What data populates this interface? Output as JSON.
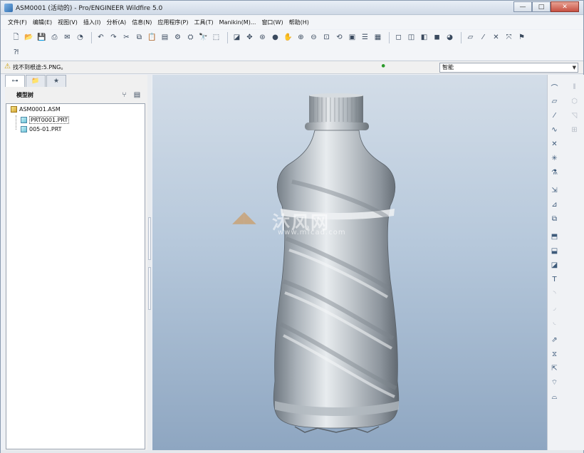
{
  "window": {
    "title": "ASM0001 (活动的) - Pro/ENGINEER Wildfire 5.0",
    "minimize": "—",
    "maximize": "□",
    "close": "✕"
  },
  "menu": [
    "文件(F)",
    "编辑(E)",
    "视图(V)",
    "插入(I)",
    "分析(A)",
    "信息(N)",
    "应用程序(P)",
    "工具(T)",
    "Manikin(M)...",
    "窗口(W)",
    "帮助(H)"
  ],
  "message": {
    "icon": "warning-icon",
    "text": "找不到根途:5.PNG。"
  },
  "filter": {
    "value": "智能"
  },
  "model_tree": {
    "title": "模型树",
    "nodes": [
      {
        "label": "ASM0001.ASM",
        "type": "assembly"
      },
      {
        "label": "PRT0001.PRT",
        "type": "part"
      },
      {
        "label": "005-01.PRT",
        "type": "part"
      }
    ]
  },
  "watermark": {
    "text": "沐风网",
    "url": "www.mfcad.com"
  }
}
